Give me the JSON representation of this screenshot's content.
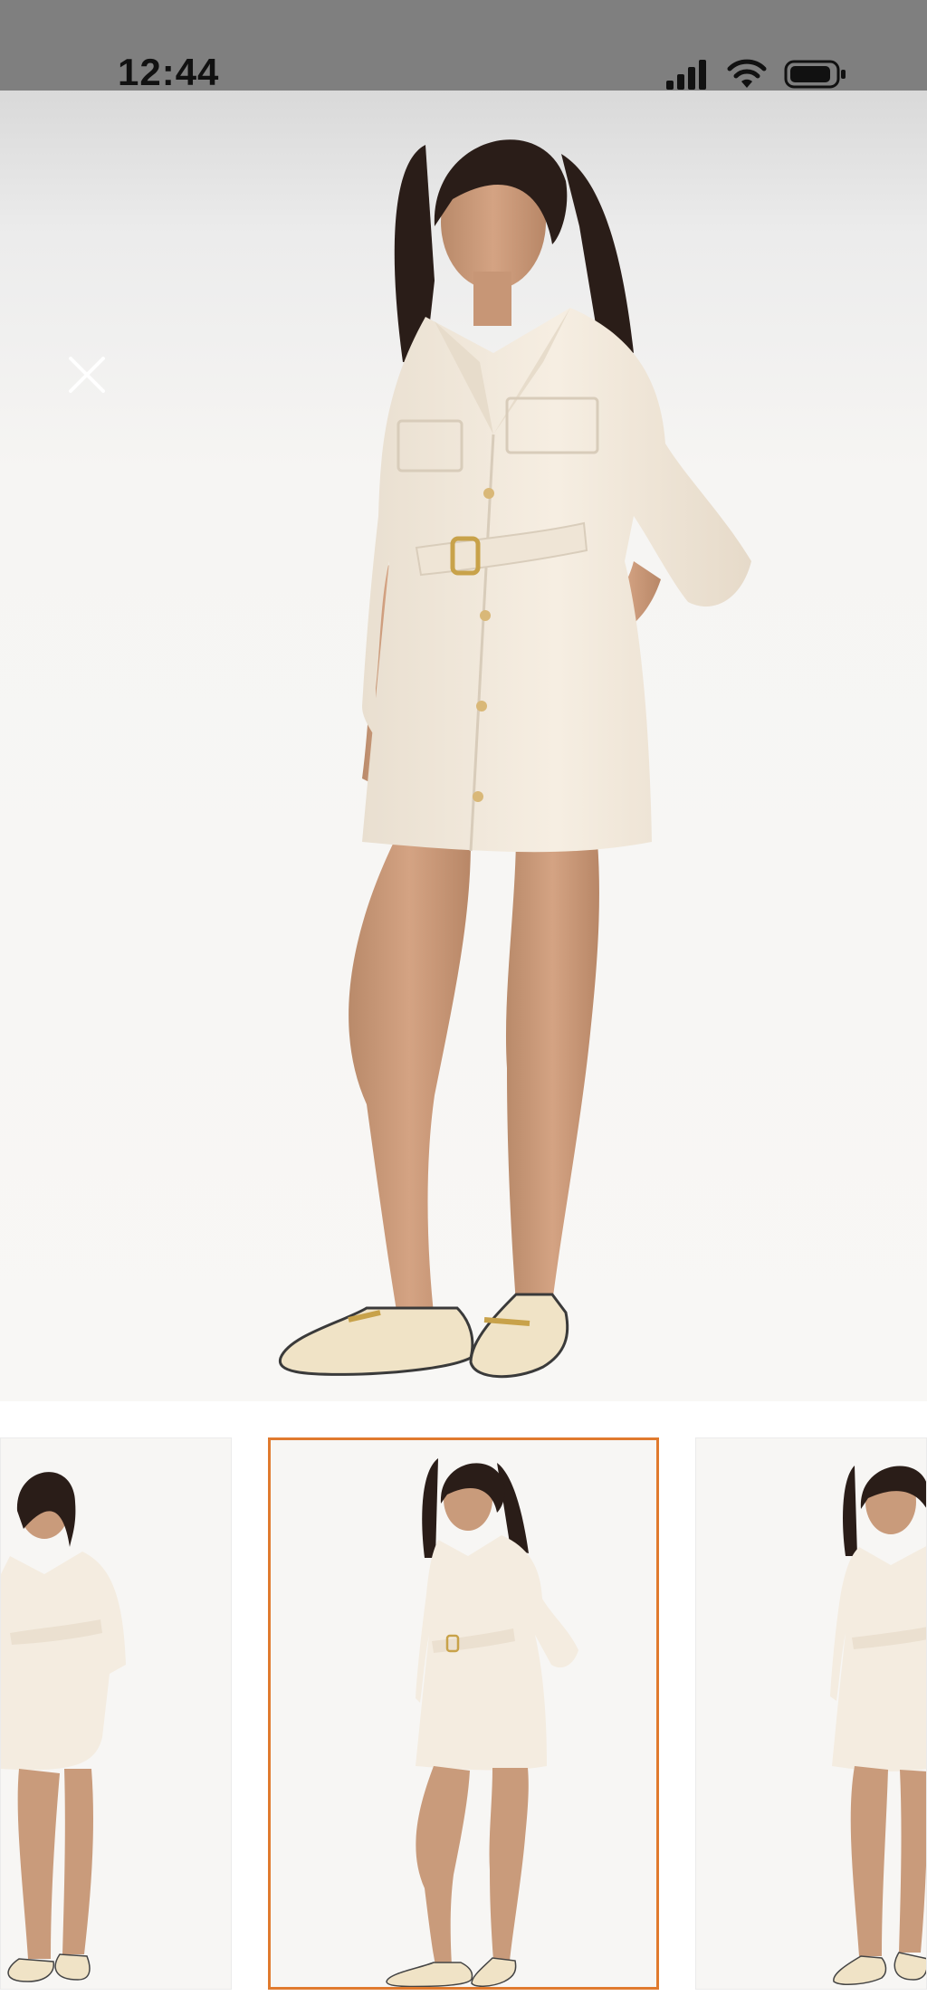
{
  "status_bar": {
    "time": "12:44",
    "icons": [
      "cellular-signal-icon",
      "wifi-icon",
      "battery-icon"
    ]
  },
  "viewer": {
    "close_icon": "close-icon",
    "selected_index": 1,
    "thumbnail_count": 3
  },
  "colors": {
    "selected_border": "#e07a2e",
    "status_bar_bg": "#7f7f7f",
    "dress": "#f4ece0",
    "loafer": "#f0e3c6"
  }
}
